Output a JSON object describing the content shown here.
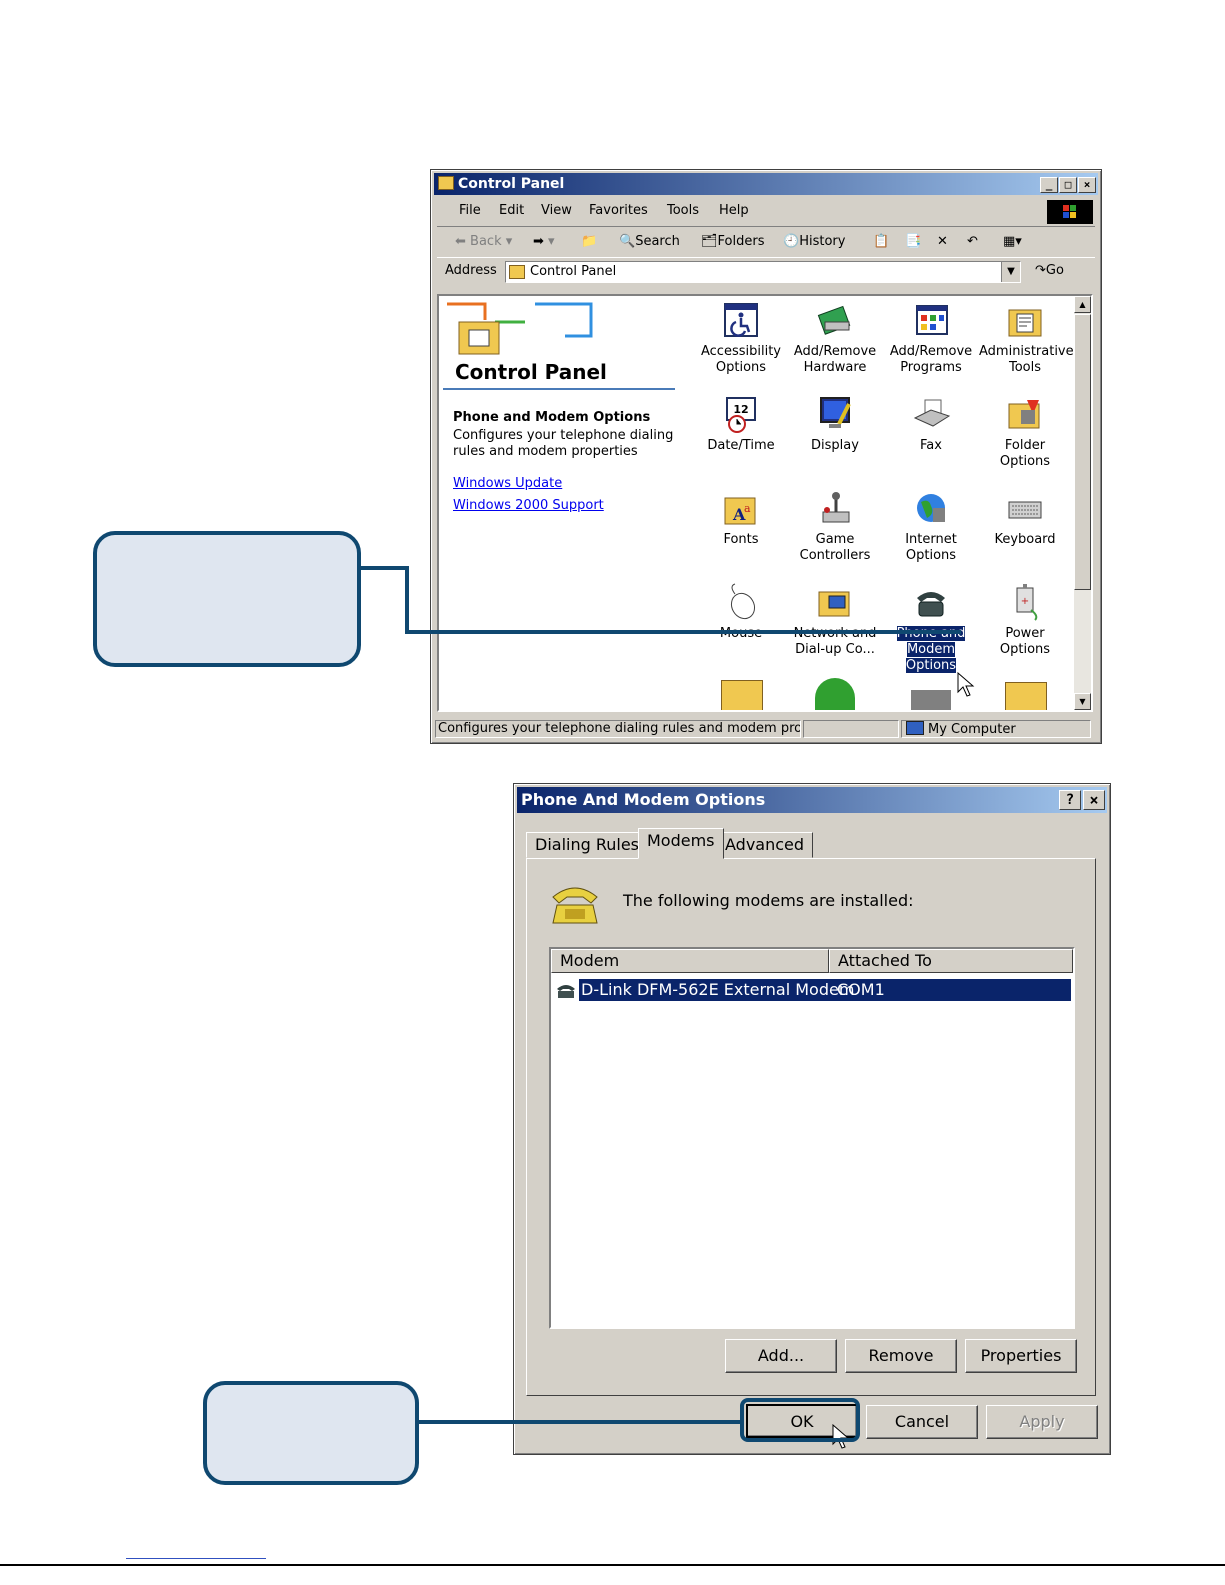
{
  "control_panel": {
    "title": "Control Panel",
    "menu": [
      "File",
      "Edit",
      "View",
      "Favorites",
      "Tools",
      "Help"
    ],
    "toolbar": {
      "back": "Back",
      "search": "Search",
      "folders": "Folders",
      "history": "History"
    },
    "address_label": "Address",
    "address_value": "Control Panel",
    "go_label": "Go",
    "sidebar": {
      "heading": "Control Panel",
      "item_title": "Phone and Modem Options",
      "item_desc": "Configures your telephone dialing rules and modem properties",
      "links": [
        "Windows Update",
        "Windows 2000 Support"
      ]
    },
    "icons": [
      {
        "label": "Accessibility Options",
        "icon": "accessibility-icon"
      },
      {
        "label": "Add/Remove Hardware",
        "icon": "hardware-icon"
      },
      {
        "label": "Add/Remove Programs",
        "icon": "programs-icon"
      },
      {
        "label": "Administrative Tools",
        "icon": "admin-tools-icon"
      },
      {
        "label": "Date/Time",
        "icon": "clock-icon"
      },
      {
        "label": "Display",
        "icon": "display-icon"
      },
      {
        "label": "Fax",
        "icon": "fax-icon"
      },
      {
        "label": "Folder Options",
        "icon": "folder-options-icon"
      },
      {
        "label": "Fonts",
        "icon": "fonts-icon"
      },
      {
        "label": "Game Controllers",
        "icon": "joystick-icon"
      },
      {
        "label": "Internet Options",
        "icon": "internet-icon"
      },
      {
        "label": "Keyboard",
        "icon": "keyboard-icon"
      },
      {
        "label": "Mouse",
        "icon": "mouse-icon"
      },
      {
        "label": "Network and Dial-up Co...",
        "icon": "network-icon"
      },
      {
        "label": "Phone and Modem Options",
        "icon": "phone-icon",
        "selected": true
      },
      {
        "label": "Power Options",
        "icon": "power-icon"
      }
    ],
    "status_text": "Configures your telephone dialing rules and modem properti",
    "status_zone": "My Computer"
  },
  "phone_dialog": {
    "title": "Phone And Modem Options",
    "help_button": "?",
    "close_button": "x",
    "tabs": [
      "Dialing Rules",
      "Modems",
      "Advanced"
    ],
    "active_tab": "Modems",
    "intro": "The following modems are  installed:",
    "columns": [
      "Modem",
      "Attached To"
    ],
    "rows": [
      {
        "modem": "D-Link DFM-562E External Modem",
        "attached_to": "COM1"
      }
    ],
    "buttons": {
      "add": "Add...",
      "remove": "Remove",
      "properties": "Properties",
      "ok": "OK",
      "cancel": "Cancel",
      "apply": "Apply"
    }
  },
  "colors": {
    "title_start": "#0a246a",
    "title_end": "#a6caf0",
    "selection": "#0a246a",
    "callout_border": "#0f4870",
    "callout_fill": "#dfe6f0"
  }
}
